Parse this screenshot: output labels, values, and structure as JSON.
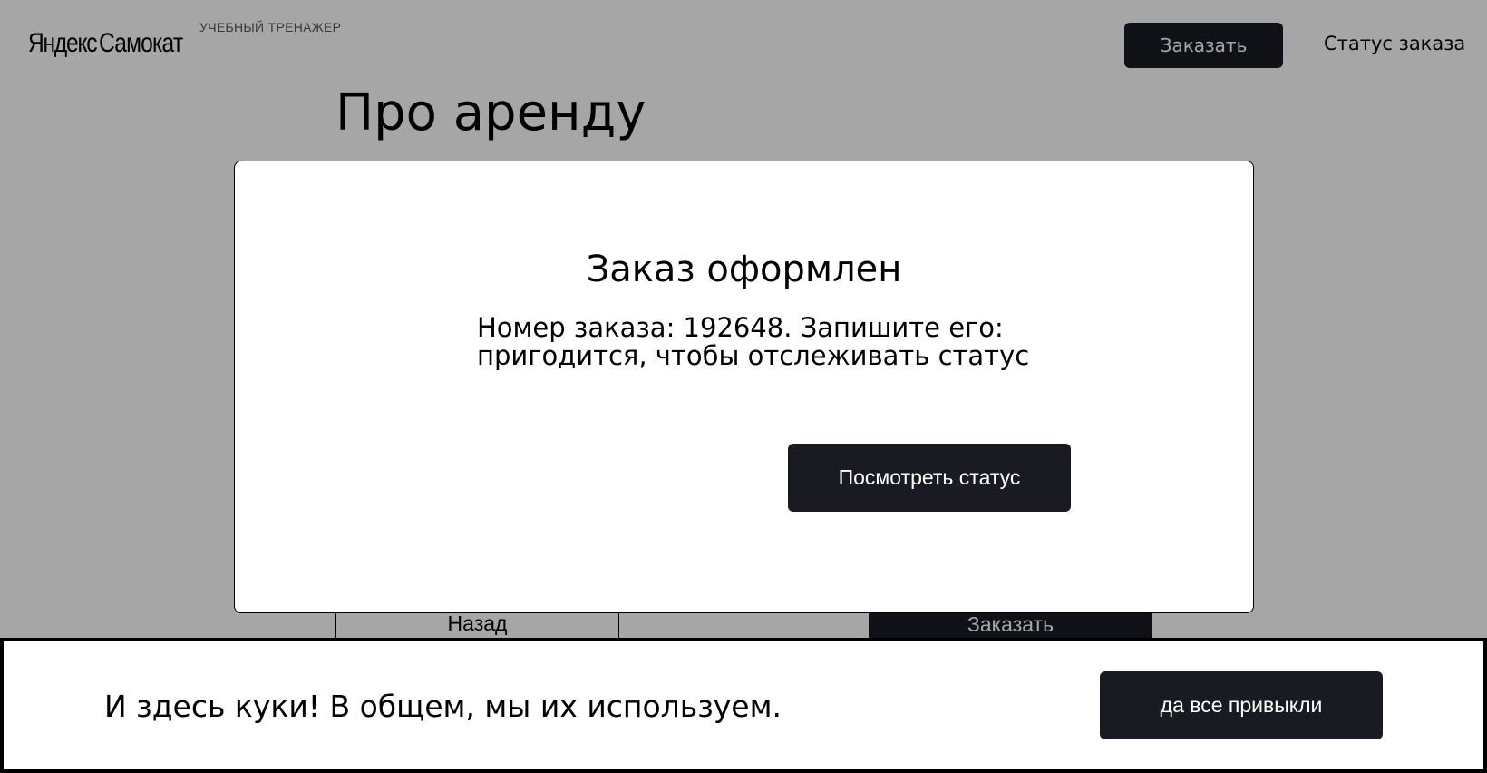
{
  "header": {
    "logo_yandex": "Яндекс",
    "logo_samokat": "Самокат",
    "logo_subtitle": "УЧЕБНЫЙ ТРЕНАЖЕР",
    "order_button": "Заказать",
    "status_link": "Статус заказа"
  },
  "main": {
    "title": "Про аренду",
    "back_button": "Назад",
    "order_button": "Заказать"
  },
  "modal": {
    "title": "Заказ оформлен",
    "text": "Номер заказа: 192648.  Запишите его:\nпригодится, чтобы отслеживать статус",
    "view_status_button": "Посмотреть статус"
  },
  "cookie": {
    "text": "И здесь куки! В общем, мы их используем.",
    "accept_button": "да все привыкли"
  },
  "colors": {
    "button_dark": "#1a1b22",
    "overlay": "rgba(0,0,0,0.35)"
  }
}
